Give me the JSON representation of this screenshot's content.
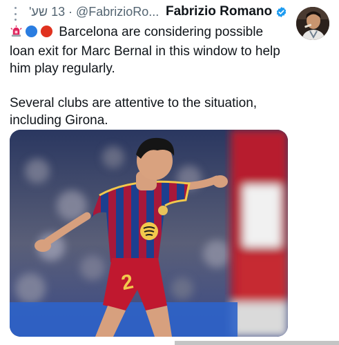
{
  "tweet": {
    "time": "13 שע'",
    "separator": "·",
    "handle": "@FabrizioRo...",
    "author_name": "Fabrizio Romano",
    "verified": true,
    "emojis": [
      "rotating-light-icon",
      "blue-circle-icon",
      "red-circle-icon"
    ],
    "text": "Barcelona are considering possible loan exit for Marc Bernal in this window to help him play regularly.\n\nSeveral clubs are attentive to the situation, including Girona."
  },
  "media": {
    "jersey_number": "2",
    "colors": {
      "blue": "#1c3f8f",
      "garnet": "#a8183a",
      "yellow": "#f2c94c"
    }
  },
  "colors": {
    "verified": "#1d9bf0",
    "muted": "#536471",
    "text": "#0f1419"
  }
}
